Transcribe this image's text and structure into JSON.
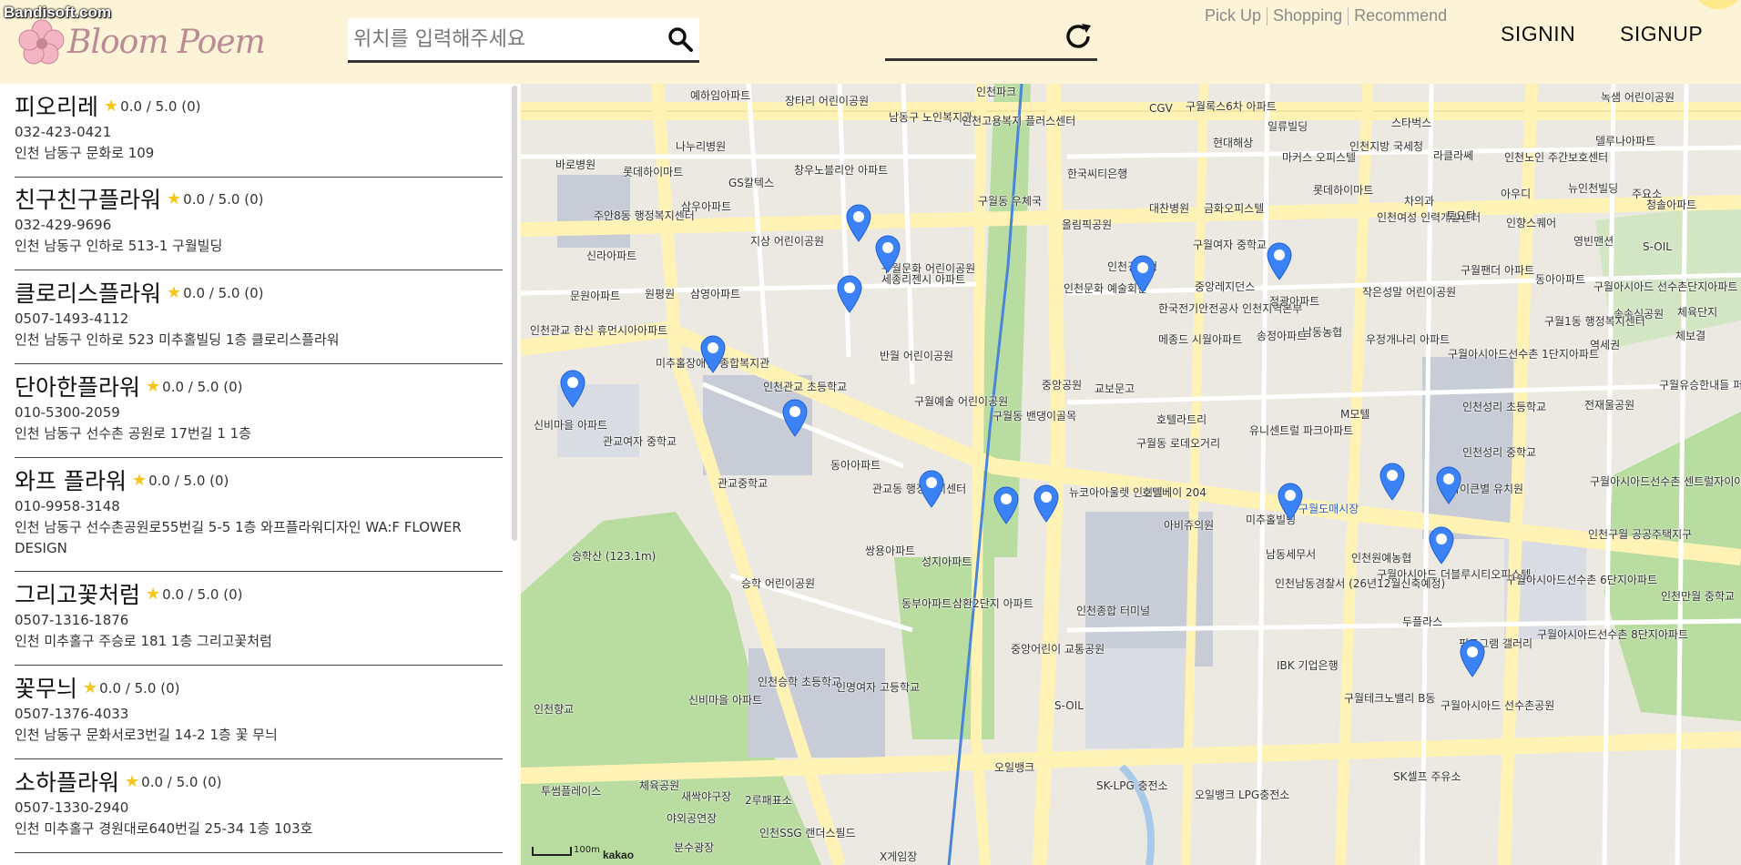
{
  "watermark": "Bandisoft.com",
  "logo": {
    "text": "Bloom Poem"
  },
  "search": {
    "placeholder": "위치를 입력해주세요"
  },
  "nav": {
    "links": [
      "Pick Up",
      "Shopping",
      "Recommend"
    ],
    "signin": "SIGNIN",
    "signup": "SIGNUP"
  },
  "shops": [
    {
      "name": "피오리레",
      "rating": "0.0 / 5.0 (0)",
      "phone": "032-423-0421",
      "address": "인천 남동구 문화로 109"
    },
    {
      "name": "친구친구플라워",
      "rating": "0.0 / 5.0 (0)",
      "phone": "032-429-9696",
      "address": "인천 남동구 인하로 513-1 구월빌딩"
    },
    {
      "name": "클로리스플라워",
      "rating": "0.0 / 5.0 (0)",
      "phone": "0507-1493-4112",
      "address": "인천 남동구 인하로 523 미추홀빌딩 1층 클로리스플라워"
    },
    {
      "name": "단아한플라워",
      "rating": "0.0 / 5.0 (0)",
      "phone": "010-5300-2059",
      "address": "인천 남동구 선수촌 공원로 17번길 1 1층"
    },
    {
      "name": "와프 플라워",
      "rating": "0.0 / 5.0 (0)",
      "phone": "010-9958-3148",
      "address": "인천 남동구 선수촌공원로55번길 5-5 1층 와프플라워디자인 WA:F FLOWER DESIGN"
    },
    {
      "name": "그리고꽃처럼",
      "rating": "0.0 / 5.0 (0)",
      "phone": "0507-1316-1876",
      "address": "인천 미추홀구 주승로 181 1층 그리고꽃처럼"
    },
    {
      "name": "꽃무늬",
      "rating": "0.0 / 5.0 (0)",
      "phone": "0507-1376-4033",
      "address": "인천 남동구 문화서로3번길 14-2 1층 꽃 무늬"
    },
    {
      "name": "소하플라워",
      "rating": "0.0 / 5.0 (0)",
      "phone": "0507-1330-2940",
      "address": "인천 미추홀구 경원대로640번길 25-34 1층 103호"
    }
  ],
  "map": {
    "attribution": "kakao",
    "scale": "100m",
    "labels": {
      "l1": "예하임아파트",
      "l2": "장타리 어린이공원",
      "l3": "남동구 노인복지관",
      "l4": "인천고용복지 플러스센터",
      "l5": "구월록스6차 아파트",
      "l6": "일류빌딩",
      "l7": "스타벅스",
      "l8": "나누리병원",
      "l9": "현대해상",
      "l10": "바로병원",
      "l11": "롯데하이마트",
      "l12": "GS칼텍스",
      "l13": "창우노블리안 아파트",
      "l14": "구월동 우체국",
      "l15": "대찬병원",
      "l16": "금화오피스텔",
      "l17": "주안8동 행정복지센터",
      "l18": "삼우아파트",
      "l19": "올림픽공원",
      "l20": "인천경찰청",
      "l21": "구월여자 중학교",
      "l22": "신라아파트",
      "l23": "지상 어린이공원",
      "l24": "구월문화 어린이공원",
      "l25": "세종리젠시 아파트",
      "l26": "인천문화 예술회관",
      "l27": "중앙레지던스",
      "l28": "문원아파트",
      "l29": "원평원",
      "l30": "삼영아파트",
      "l31": "한국전기안전공사 인천지역본부",
      "l32": "정광아파트",
      "l33": "메종드 시월아파트",
      "l34": "송정아파트",
      "l35": "남동농협",
      "l36": "인천관교 한신 휴먼시아아파트",
      "l37": "미추홀장애인 종합복지관",
      "l38": "인천관교 초등학교",
      "l39": "반월 어린이공원",
      "l40": "중앙공원",
      "l41": "교보문고",
      "l42": "구월예술 어린이공원",
      "l43": "구월동 밴댕이골목",
      "l44": "호텔라트리",
      "l45": "유니센트럴 파크아파트",
      "l46": "신비마을 아파트",
      "l47": "관교여자 중학교",
      "l48": "관교중학교",
      "l49": "동아아파트",
      "l50": "구월동 로데오거리",
      "l51": "관교동 행정복지센터",
      "l52": "뉴코아아울렛 인천점",
      "l53": "호텔베이 204",
      "l54": "아비쥬의원",
      "l55": "미추홀빌딩",
      "l56": "구월도매시장",
      "l57": "승학산 (123.1m)",
      "l58": "쌍용아파트",
      "l59": "성지아파트",
      "l60": "승학 어린이공원",
      "l61": "동부아파트",
      "l62": "삼환2단지 아파트",
      "l63": "인천종합 터미널",
      "l64": "중앙어린이 교통공원",
      "l65": "남동세무서",
      "l66": "인천남동경찰서 (26년12월신축예정)",
      "l67": "IBK 기업은행",
      "l68": "인천승학 초등학교",
      "l69": "인명여자 고등학교",
      "l70": "신비마을 아파트",
      "l71": "S-OIL",
      "l72": "인천향교",
      "l73": "오일뱅크",
      "l74": "SK-LPG 충전소",
      "l75": "오일뱅크 LPG충전소",
      "l76": "SK셀프 주유소",
      "l77": "투썸플레이스",
      "l78": "체육공원",
      "l79": "새싹야구장",
      "l80": "2루패표소",
      "l81": "야외공연장",
      "l82": "인천SSG 랜더스필드",
      "l83": "분수광장",
      "l84": "X게임장",
      "l85": "인천여성 인력개발센터",
      "l86": "토요타",
      "l87": "인향스퀘어",
      "l88": "영빈맨션",
      "l89": "구월팬더 아파트",
      "l90": "작은성말 어린이공원",
      "l91": "우정개나리 아파트",
      "l92": "구월아시아드선수촌 1단지아파트",
      "l93": "인천성리 초등학교",
      "l94": "인천성리 중학교",
      "l95": "M모텔",
      "l96": "아이큰별 유치원",
      "l97": "인천원예농협",
      "l98": "구월아시아드 더블루시티오피스텔",
      "l99": "두플라스",
      "l100": "구월테크노밸리 B동",
      "l101": "픽토그램 갤러리",
      "l102": "구월아시아드 선수촌공원",
      "l103": "롯데하이마트",
      "l104": "아우디",
      "l105": "뉴인천빌딩",
      "l106": "청솔아파트",
      "l107": "라클라쎄",
      "l108": "인천노인 주간보호센터",
      "l109": "인천지방 국세청",
      "l110": "마커스 오피스텔",
      "l111": "구월1동 행정복지센터",
      "l112": "전재울공원",
      "l113": "구월유승한내들 퍼스티지아파트",
      "l114": "인천구월 공공주택지구",
      "l115": "구월아시아드선수촌 센트럴자이아파트",
      "l116": "구월아시아드선수촌 6단지아파트",
      "l117": "인천만월 중학교",
      "l118": "구월아시아드선수촌 8단지아파트",
      "l119": "송속식공원",
      "l120": "역세권",
      "l121": "체육단지",
      "l122": "구월아시아드 선수촌단지아파트",
      "l123": "동아아파트",
      "l124": "CGV",
      "l125": "한국씨티은행",
      "l126": "체보결",
      "l127": "S-OIL",
      "l128": "주요소",
      "l129": "녹샘 어린이공원",
      "l130": "델루나아파트",
      "l131": "차의과",
      "l132": "인천파크"
    }
  }
}
